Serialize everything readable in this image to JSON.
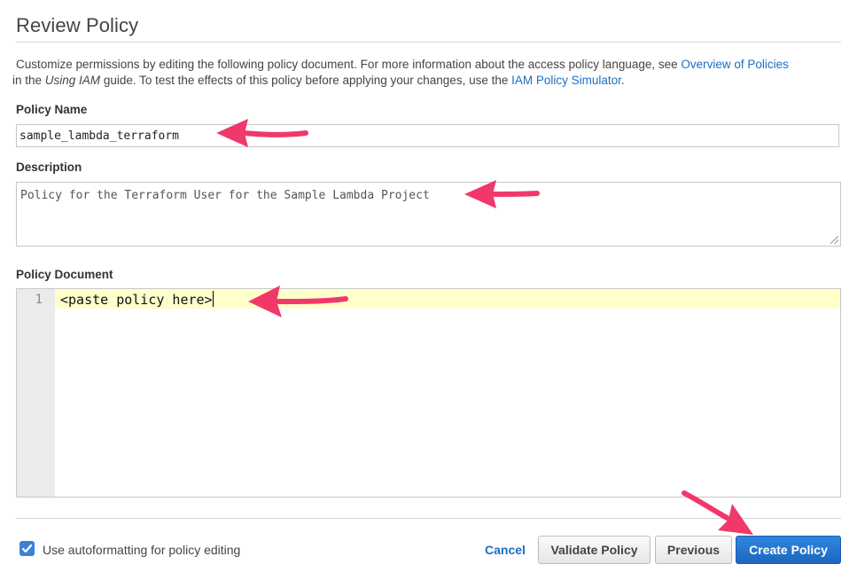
{
  "page": {
    "title": "Review Policy",
    "intro": {
      "part1": "Customize permissions by editing the following policy document. For more information about the access policy language, see ",
      "link1": "Overview of Policies",
      "part2": " in the ",
      "italic": "Using IAM",
      "part3": " guide. To test the effects of this policy before applying your changes, use the ",
      "link2": "IAM Policy Simulator",
      "part4": "."
    }
  },
  "form": {
    "policy_name_label": "Policy Name",
    "policy_name_value": "sample_lambda_terraform",
    "description_label": "Description",
    "description_value": "Policy for the Terraform User for the Sample Lambda Project",
    "policy_document_label": "Policy Document",
    "editor": {
      "line_number": "1",
      "content": "<paste policy here>"
    }
  },
  "footer": {
    "autoformat_label": "Use autoformatting for policy editing",
    "autoformat_checked": true,
    "cancel_label": "Cancel",
    "validate_label": "Validate Policy",
    "previous_label": "Previous",
    "create_label": "Create Policy"
  },
  "colors": {
    "link": "#1a6fc4",
    "primary_button": "#1c66c0",
    "annotation_arrow": "#f0386b",
    "active_line": "#ffffcc"
  }
}
